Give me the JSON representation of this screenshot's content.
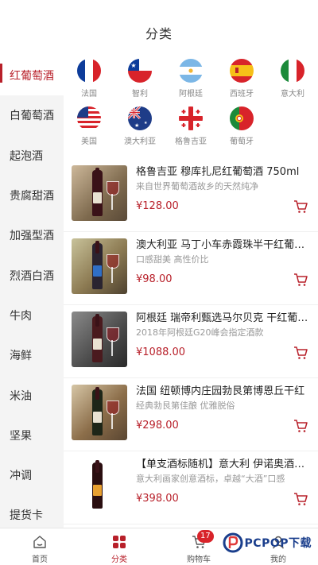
{
  "header": {
    "title": "分类"
  },
  "sidebar": {
    "items": [
      {
        "label": "红葡萄酒",
        "active": true
      },
      {
        "label": "白葡萄酒"
      },
      {
        "label": "起泡酒"
      },
      {
        "label": "贵腐甜酒"
      },
      {
        "label": "加强型酒"
      },
      {
        "label": "烈酒白酒"
      },
      {
        "label": "牛肉"
      },
      {
        "label": "海鲜"
      },
      {
        "label": "米油"
      },
      {
        "label": "坚果"
      },
      {
        "label": "冲调"
      },
      {
        "label": "提货卡"
      }
    ]
  },
  "countries": [
    {
      "label": "法国",
      "icon": "france-flag-icon"
    },
    {
      "label": "智利",
      "icon": "chile-flag-icon"
    },
    {
      "label": "阿根廷",
      "icon": "argentina-flag-icon"
    },
    {
      "label": "西班牙",
      "icon": "spain-flag-icon"
    },
    {
      "label": "意大利",
      "icon": "italy-flag-icon"
    },
    {
      "label": "美国",
      "icon": "usa-flag-icon"
    },
    {
      "label": "澳大利亚",
      "icon": "australia-flag-icon"
    },
    {
      "label": "格鲁吉亚",
      "icon": "georgia-flag-icon"
    },
    {
      "label": "葡萄牙",
      "icon": "portugal-flag-icon"
    }
  ],
  "products": [
    {
      "title": "格鲁吉亚 穆库扎尼红葡萄酒 750ml",
      "subtitle": "来自世界葡萄酒故乡的天然纯净",
      "price": "¥128.00"
    },
    {
      "title": "澳大利亚 马丁小车赤霞珠半干红葡萄酒",
      "subtitle": "口感甜美 高性价比",
      "price": "¥98.00"
    },
    {
      "title": "阿根廷 瑞帝利甄选马尔贝克 干红葡萄酒",
      "subtitle": "2018年阿根廷G20峰会指定酒款",
      "price": "¥1088.00"
    },
    {
      "title": "法国 纽顿博内庄园勃艮第博恩丘干红",
      "subtitle": "经典勃艮第佳酿 优雅脱俗",
      "price": "¥298.00"
    },
    {
      "title": "【单支酒标随机】意大利 伊诺奥酒庄干红",
      "subtitle": "意大利画家创意酒标，卓越“大酒”口感",
      "price": "¥398.00"
    }
  ],
  "tabbar": {
    "items": [
      {
        "label": "首页",
        "icon": "home-icon"
      },
      {
        "label": "分类",
        "icon": "category-grid-icon",
        "active": true
      },
      {
        "label": "购物车",
        "icon": "cart-icon",
        "badge": "17"
      },
      {
        "label": "我的",
        "icon": "user-icon"
      }
    ]
  },
  "watermark": {
    "text": "PCPOP下载"
  },
  "colors": {
    "accent": "#b8202a",
    "sidebar_bg": "#f4f4f4",
    "badge": "#d8232a"
  }
}
